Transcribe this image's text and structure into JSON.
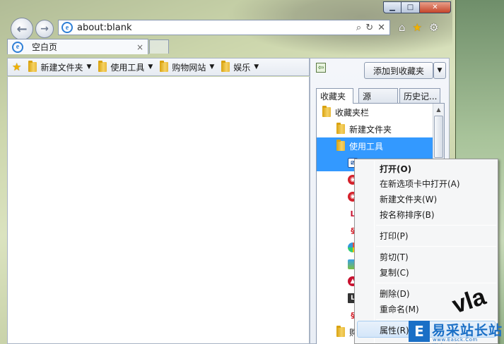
{
  "window": {
    "minimize_label": "▁",
    "maximize_label": "□",
    "close_label": "✕"
  },
  "nav": {
    "address": "about:blank",
    "back_icon": "←",
    "forward_icon": "→",
    "search_icon": "⌕",
    "refresh_icon": "↻",
    "stop_icon": "✕",
    "home_icon": "⌂",
    "favorites_icon": "★",
    "tools_icon": "⚙"
  },
  "tabs": [
    {
      "label": "空白页",
      "close": "×"
    }
  ],
  "favorites_bar": {
    "items": [
      {
        "label": "新建文件夹",
        "caret": "▼"
      },
      {
        "label": "使用工具",
        "caret": "▼"
      },
      {
        "label": "购物网站",
        "caret": "▼"
      },
      {
        "label": "娱乐",
        "caret": "▼"
      }
    ]
  },
  "favorites_center": {
    "add_button": "添加到收藏夹",
    "add_dropdown": "▼",
    "tabs": [
      {
        "label": "收藏夹"
      },
      {
        "label": "源"
      },
      {
        "label": "历史记..."
      }
    ],
    "tree": [
      {
        "label": "收藏夹栏"
      },
      {
        "label": "新建文件夹"
      },
      {
        "label": "使用工具"
      },
      {
        "label": "购"
      }
    ]
  },
  "context_menu": {
    "items": [
      {
        "label": "打开(O)"
      },
      {
        "label": "在新选项卡中打开(A)"
      },
      {
        "label": "新建文件夹(W)"
      },
      {
        "label": "按名称排序(B)"
      },
      {
        "label": "打印(P)"
      },
      {
        "label": "剪切(T)"
      },
      {
        "label": "复制(C)"
      },
      {
        "label": "删除(D)"
      },
      {
        "label": "重命名(M)"
      },
      {
        "label": "属性(R)"
      }
    ]
  },
  "watermark": {
    "big": "vla",
    "logo_letter": "E",
    "logo_text": "易采站长站",
    "logo_sub": "www.Easck.Com Webmaster"
  },
  "colors": {
    "selection": "#3399ff",
    "brand_blue": "#1a6fc6"
  }
}
